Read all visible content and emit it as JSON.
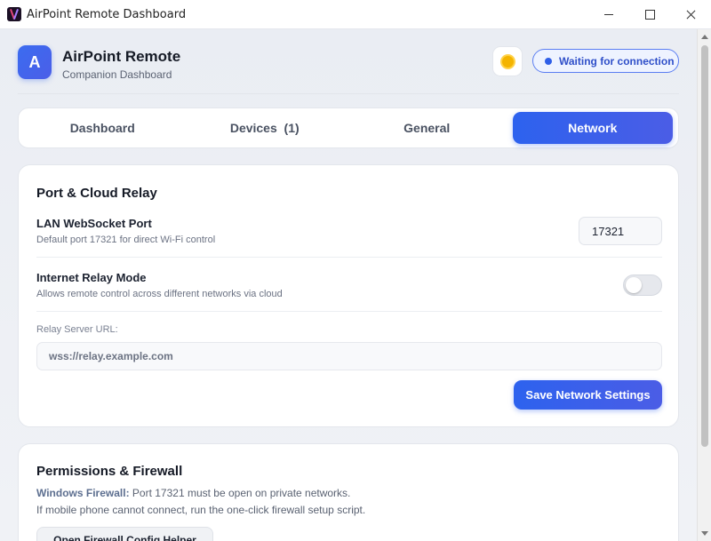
{
  "window": {
    "title": "AirPoint Remote Dashboard"
  },
  "header": {
    "logo_letter": "A",
    "app_name": "AirPoint Remote",
    "app_subtitle": "Companion Dashboard",
    "theme_icon": "sun-icon",
    "status_text": "Waiting for connection",
    "status_color": "#2f5fe8"
  },
  "tabs": [
    {
      "label": "Dashboard",
      "active": false
    },
    {
      "label": "Devices  (1)",
      "active": false
    },
    {
      "label": "General",
      "active": false
    },
    {
      "label": "Network",
      "active": true
    }
  ],
  "network_card": {
    "title": "Port & Cloud Relay",
    "lan_port": {
      "label": "LAN WebSocket Port",
      "description": "Default port 17321 for direct Wi-Fi control",
      "value": "17321"
    },
    "relay_mode": {
      "label": "Internet Relay Mode",
      "description": "Allows remote control across different networks via cloud",
      "enabled": false
    },
    "relay_url": {
      "label": "Relay Server URL:",
      "placeholder": "wss://relay.example.com",
      "value": ""
    },
    "save_button": "Save Network Settings"
  },
  "firewall_card": {
    "title": "Permissions & Firewall",
    "line1_strong": "Windows Firewall:",
    "line1_rest": " Port 17321 must be open on private networks.",
    "line2": "If mobile phone cannot connect, run the one-click firewall setup script.",
    "button": "Open Firewall Config Helper"
  },
  "colors": {
    "accent": "#2d62ee",
    "accent_secondary": "#4b5de6"
  }
}
